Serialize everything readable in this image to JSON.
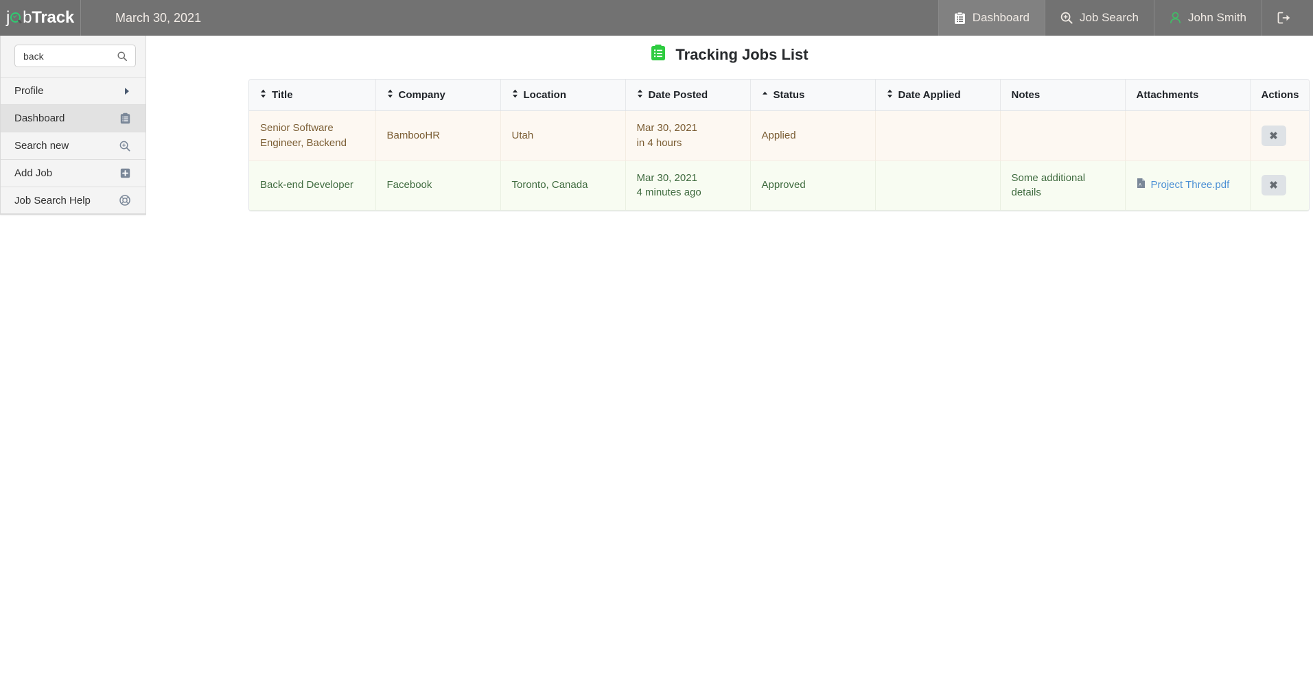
{
  "topbar": {
    "brand": {
      "part1": "j",
      "glass_icon": "magnifier-check-icon",
      "part2": "b",
      "part3": "Track"
    },
    "date": "March 30, 2021",
    "nav": [
      {
        "label": "Dashboard",
        "icon": "clipboard-icon",
        "active": true
      },
      {
        "label": "Job Search",
        "icon": "search-plus-icon",
        "active": false
      },
      {
        "label": "John Smith",
        "icon": "user-icon",
        "active": false
      },
      {
        "label": "",
        "icon": "logout-icon",
        "active": false
      }
    ]
  },
  "sidebar": {
    "search": {
      "value": "back",
      "placeholder": "Search",
      "icon": "search-icon"
    },
    "items": [
      {
        "label": "Profile",
        "icon": "chevron-right-icon",
        "active": false
      },
      {
        "label": "Dashboard",
        "icon": "clipboard-list-icon",
        "active": true
      },
      {
        "label": "Search new",
        "icon": "search-plus-icon",
        "active": false
      },
      {
        "label": "Add Job",
        "icon": "plus-square-icon",
        "active": false
      },
      {
        "label": "Job Search Help",
        "icon": "lifebuoy-icon",
        "active": false
      }
    ]
  },
  "main": {
    "title": "Tracking Jobs List",
    "title_icon": "clipboard-list-green-icon",
    "table": {
      "columns": [
        {
          "label": "Title",
          "sort": "both"
        },
        {
          "label": "Company",
          "sort": "both"
        },
        {
          "label": "Location",
          "sort": "both"
        },
        {
          "label": "Date Posted",
          "sort": "both"
        },
        {
          "label": "Status",
          "sort": "asc"
        },
        {
          "label": "Date Applied",
          "sort": "both"
        },
        {
          "label": "Notes",
          "sort": "none"
        },
        {
          "label": "Attachments",
          "sort": "none"
        },
        {
          "label": "Actions",
          "sort": "none"
        }
      ],
      "rows": [
        {
          "variant": "applied",
          "title": "Senior Software Engineer, Backend",
          "company": "BambooHR",
          "location": "Utah",
          "date_posted": "Mar 30, 2021",
          "date_posted_rel": "in 4 hours",
          "status": "Applied",
          "date_applied": "",
          "notes": "",
          "attachment": "",
          "action_label": "✖"
        },
        {
          "variant": "approved",
          "title": "Back-end Developer",
          "company": "Facebook",
          "location": "Toronto, Canada",
          "date_posted": "Mar 30, 2021",
          "date_posted_rel": "4 minutes ago",
          "status": "Approved",
          "date_applied": "",
          "notes": "Some additional details",
          "attachment": "Project Three.pdf",
          "action_label": "✖"
        }
      ]
    }
  },
  "colors": {
    "topbar_bg": "#727272",
    "topbar_active": "#818181",
    "sidebar_bg": "#f4f4f4",
    "sidebar_active": "#e2e2e2",
    "row_applied_bg": "#fdf8f2",
    "row_applied_text": "#7a5c32",
    "row_approved_bg": "#f8fcf2",
    "row_approved_text": "#3f6b3f",
    "accent_green": "#2ecc71",
    "link_blue": "#4a8fd4"
  }
}
